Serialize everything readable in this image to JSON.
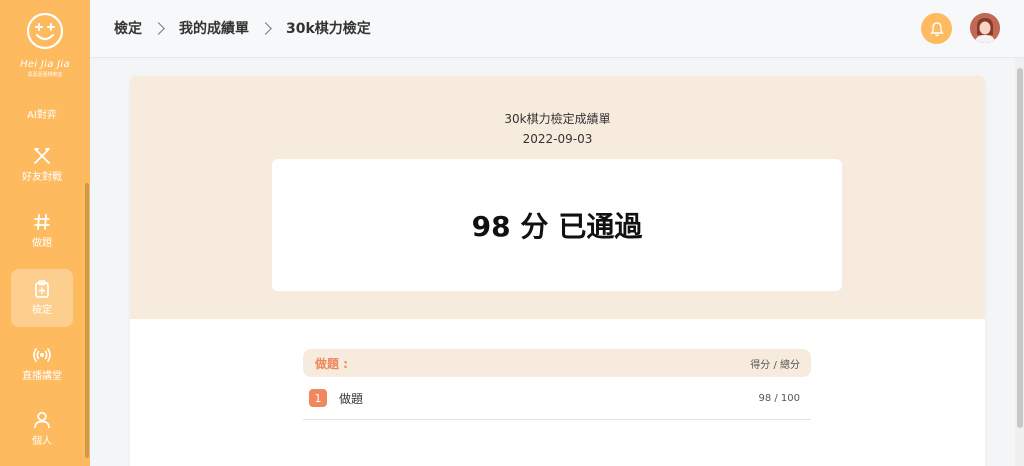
{
  "sidebar": {
    "logo_text": "Hei Jia Jia",
    "logo_sub": "黑嘉嘉圍棋教室",
    "items": [
      {
        "label": "AI對弈",
        "icon": "robot-icon"
      },
      {
        "label": "好友對戰",
        "icon": "crossed-swords-icon"
      },
      {
        "label": "做題",
        "icon": "hash-icon"
      },
      {
        "label": "檢定",
        "icon": "clipboard-icon",
        "active": true
      },
      {
        "label": "直播講堂",
        "icon": "broadcast-icon"
      },
      {
        "label": "個人",
        "icon": "user-icon"
      }
    ]
  },
  "header": {
    "breadcrumb": [
      "檢定",
      "我的成績單",
      "30k棋力檢定"
    ],
    "notification_icon": "bell-icon",
    "avatar_icon": "avatar"
  },
  "certificate": {
    "title": "30k棋力檢定成績單",
    "date": "2022-09-03",
    "score": "98 分",
    "result": "已通過"
  },
  "results_table": {
    "header_left": "做題 :",
    "header_right": "得分 / 總分",
    "rows": [
      {
        "index": "1",
        "name": "做題",
        "score": "98 / 100"
      }
    ]
  },
  "colors": {
    "sidebar": "#fdba5f",
    "accent": "#f0885e",
    "card_top": "#f6ebdd"
  }
}
